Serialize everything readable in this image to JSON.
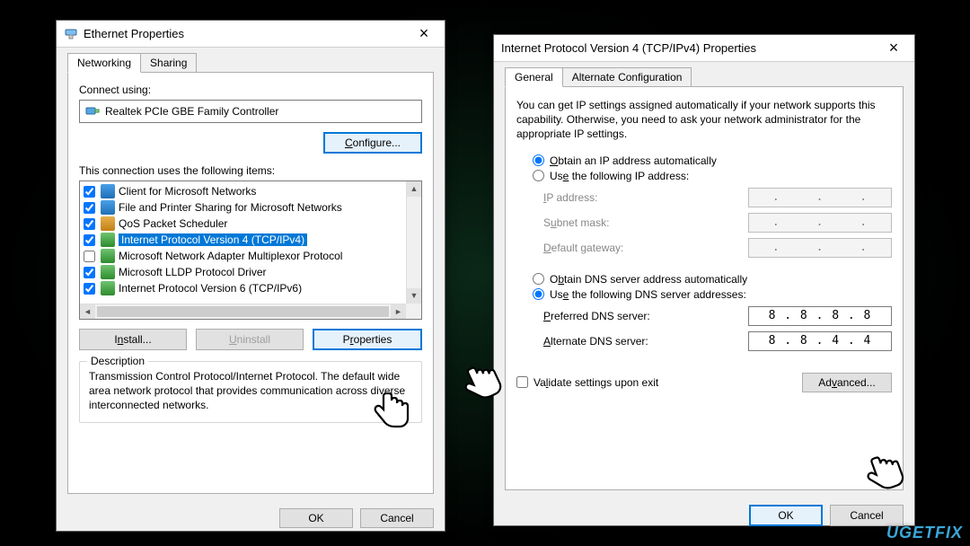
{
  "dialog1": {
    "title": "Ethernet Properties",
    "tabs": [
      "Networking",
      "Sharing"
    ],
    "activeTab": 0,
    "connectUsingLabel": "Connect using:",
    "adapter": "Realtek PCIe GBE Family Controller",
    "configureBtn": "Configure...",
    "itemsLabel": "This connection uses the following items:",
    "items": [
      {
        "checked": true,
        "icon": "client",
        "text": "Client for Microsoft Networks"
      },
      {
        "checked": true,
        "icon": "client",
        "text": "File and Printer Sharing for Microsoft Networks"
      },
      {
        "checked": true,
        "icon": "qos",
        "text": "QoS Packet Scheduler"
      },
      {
        "checked": true,
        "icon": "ip4",
        "text": "Internet Protocol Version 4 (TCP/IPv4)",
        "selected": true
      },
      {
        "checked": false,
        "icon": "ip4",
        "text": "Microsoft Network Adapter Multiplexor Protocol"
      },
      {
        "checked": true,
        "icon": "ip4",
        "text": "Microsoft LLDP Protocol Driver"
      },
      {
        "checked": true,
        "icon": "ip4",
        "text": "Internet Protocol Version 6 (TCP/IPv6)"
      }
    ],
    "installBtn": "Install...",
    "uninstallBtn": "Uninstall",
    "propertiesBtn": "Properties",
    "descriptionLegend": "Description",
    "description": "Transmission Control Protocol/Internet Protocol. The default wide area network protocol that provides communication across diverse interconnected networks.",
    "okBtn": "OK",
    "cancelBtn": "Cancel"
  },
  "dialog2": {
    "title": "Internet Protocol Version 4 (TCP/IPv4) Properties",
    "tabs": [
      "General",
      "Alternate Configuration"
    ],
    "activeTab": 0,
    "intro": "You can get IP settings assigned automatically if your network supports this capability. Otherwise, you need to ask your network administrator for the appropriate IP settings.",
    "radioAutoIP": "Obtain an IP address automatically",
    "radioManualIP": "Use the following IP address:",
    "ipAddressLabel": "IP address:",
    "subnetLabel": "Subnet mask:",
    "gatewayLabel": "Default gateway:",
    "radioAutoDNS": "Obtain DNS server address automatically",
    "radioManualDNS": "Use the following DNS server addresses:",
    "preferredDNSLabel": "Preferred DNS server:",
    "alternateDNSLabel": "Alternate DNS server:",
    "preferredDNS": "8 . 8 . 8 . 8",
    "alternateDNS": "8 . 8 . 4 . 4",
    "validateLabel": "Validate settings upon exit",
    "advancedBtn": "Advanced...",
    "okBtn": "OK",
    "cancelBtn": "Cancel",
    "ipSelected": "auto",
    "dnsSelected": "manual"
  },
  "watermark": "UGETFIX"
}
